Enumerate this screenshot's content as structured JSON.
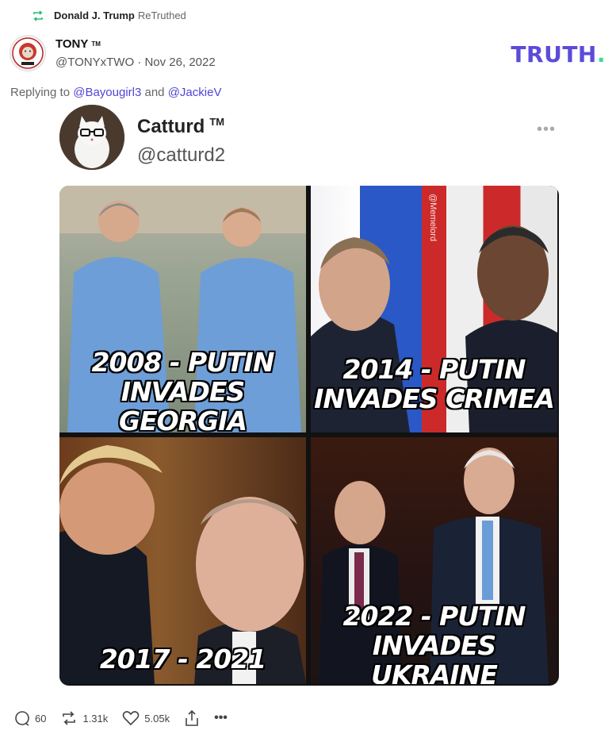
{
  "retruth": {
    "user": "Donald J. Trump",
    "action": "ReTruthed"
  },
  "post": {
    "display_name": "TONY",
    "tm": "TM",
    "handle": "@TONYxTWO",
    "separator": "·",
    "date": "Nov 26, 2022",
    "reply_prefix": "Replying to",
    "reply_user1": "@Bayougirl3",
    "reply_and": "and",
    "reply_user2": "@JackieV"
  },
  "logo": {
    "text": "TRUTH",
    "dot": "."
  },
  "embed": {
    "name": "Catturd",
    "tm": "TM",
    "handle": "@catturd2",
    "more": "•••",
    "watermark": "@Memelord",
    "panels": [
      {
        "line1": "2008 - PUTIN",
        "line2": "INVADES GEORGIA"
      },
      {
        "line1": "2014 - PUTIN",
        "line2": "INVADES CRIMEA"
      },
      {
        "line1": "2017 - 2021",
        "line2": ""
      },
      {
        "line1": "2022 - PUTIN",
        "line2": "INVADES UKRAINE"
      }
    ]
  },
  "actions": {
    "replies": "60",
    "retruths": "1.31k",
    "likes": "5.05k",
    "more": "•••"
  },
  "colors": {
    "brand": "#5b4bdb",
    "accent": "#40d69b",
    "link": "#5144d6",
    "retruth_icon": "#2eb872"
  }
}
